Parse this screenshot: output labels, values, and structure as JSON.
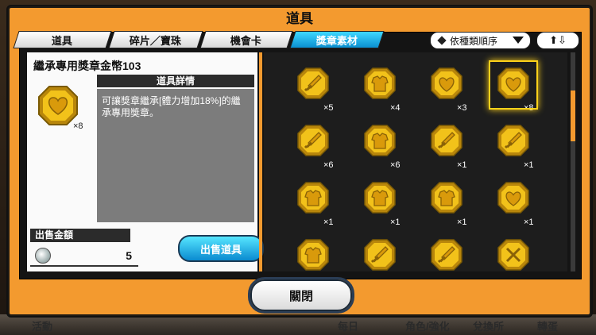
{
  "window": {
    "title": "道具"
  },
  "tabs": [
    {
      "label": "道具"
    },
    {
      "label": "碎片／寶珠"
    },
    {
      "label": "機會卡"
    },
    {
      "label": "獎章素材",
      "active": true
    }
  ],
  "sort": {
    "label": "依種類順序"
  },
  "order_toggle": {
    "label": "⬆⇩"
  },
  "detail": {
    "item_name": "繼承專用獎章金幣103",
    "count": "×8",
    "header": "道具詳情",
    "description": "可讓獎章繼承[體力增加18%]的繼承專用獎章。"
  },
  "sale": {
    "label": "出售金額",
    "price": "5",
    "sell_button": "出售道具"
  },
  "grid": {
    "items": [
      {
        "icon": "sword-medal-icon",
        "count": "×5"
      },
      {
        "icon": "armor-medal-icon",
        "count": "×4"
      },
      {
        "icon": "heart-medal-icon",
        "count": "×3"
      },
      {
        "icon": "heart-medal-icon",
        "count": "×8",
        "selected": true
      },
      {
        "icon": "sword-medal-icon",
        "count": "×6"
      },
      {
        "icon": "armor-medal-icon",
        "count": "×6"
      },
      {
        "icon": "sword-medal-icon",
        "count": "×1"
      },
      {
        "icon": "sword-medal-icon",
        "count": "×1"
      },
      {
        "icon": "armor-medal-icon",
        "count": "×1"
      },
      {
        "icon": "armor-medal-icon",
        "count": "×1"
      },
      {
        "icon": "armor-medal-icon",
        "count": "×1"
      },
      {
        "icon": "heart-medal-icon",
        "count": "×1"
      },
      {
        "icon": "armor-medal-icon",
        "count": ""
      },
      {
        "icon": "sword-medal-icon",
        "count": ""
      },
      {
        "icon": "sword-medal-icon",
        "count": ""
      },
      {
        "icon": "crossed-swords-medal-icon",
        "count": ""
      }
    ]
  },
  "close_button": {
    "label": "關閉"
  },
  "bottom_nav": [
    "活動",
    "每日",
    "角色/強化",
    "兌換所",
    "轉蛋"
  ],
  "colors": {
    "frame": "#f39a2f",
    "accent": "#0a8fd0",
    "coin": "#e8b217"
  }
}
